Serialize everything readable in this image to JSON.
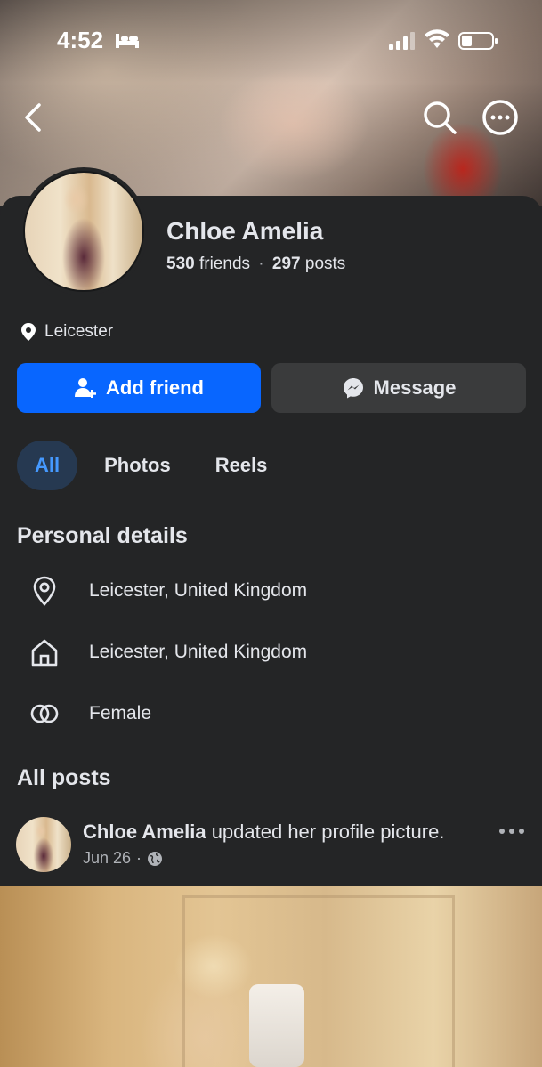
{
  "status_bar": {
    "time": "4:52"
  },
  "profile": {
    "name": "Chloe Amelia",
    "friends_count": "530",
    "friends_label": "friends",
    "posts_count": "297",
    "posts_label": "posts",
    "separator": "·",
    "location": "Leicester"
  },
  "actions": {
    "add_friend": "Add friend",
    "message": "Message"
  },
  "tabs": [
    {
      "label": "All",
      "active": true
    },
    {
      "label": "Photos",
      "active": false
    },
    {
      "label": "Reels",
      "active": false
    }
  ],
  "personal_details": {
    "title": "Personal details",
    "items": [
      {
        "icon": "location-pin-icon",
        "text": "Leicester, United Kingdom"
      },
      {
        "icon": "home-icon",
        "text": "Leicester, United Kingdom"
      },
      {
        "icon": "gender-rings-icon",
        "text": "Female"
      }
    ]
  },
  "posts": {
    "title": "All posts",
    "items": [
      {
        "author": "Chloe Amelia",
        "action": "updated her profile picture.",
        "date": "Jun 26",
        "separator": "·",
        "privacy_icon": "globe-icon"
      }
    ]
  },
  "colors": {
    "accent": "#0866ff",
    "active_tab_bg": "#263951",
    "active_tab_text": "#4599ff",
    "panel": "#242526",
    "button_secondary": "#3a3b3c"
  }
}
